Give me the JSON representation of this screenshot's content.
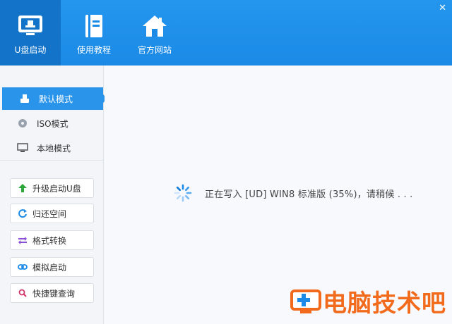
{
  "header": {
    "nav": [
      {
        "label": "U盘启动",
        "icon": "usb-monitor-icon",
        "active": true
      },
      {
        "label": "使用教程",
        "icon": "book-icon",
        "active": false
      },
      {
        "label": "官方网站",
        "icon": "home-icon",
        "active": false
      }
    ],
    "close_glyph": "✕"
  },
  "sidebar": {
    "modes": [
      {
        "label": "默认模式",
        "icon": "usb-drive-icon",
        "active": true
      },
      {
        "label": "ISO模式",
        "icon": "disc-icon",
        "active": false
      },
      {
        "label": "本地模式",
        "icon": "monitor-icon",
        "active": false
      }
    ],
    "tools": [
      {
        "label": "升级启动U盘",
        "icon": "arrow-up-icon",
        "color": "#2fa63c"
      },
      {
        "label": "归还空间",
        "icon": "refresh-icon",
        "color": "#1a8ae6"
      },
      {
        "label": "格式转换",
        "icon": "swap-icon",
        "color": "#8a4fd6"
      },
      {
        "label": "模拟启动",
        "icon": "link-icon",
        "color": "#1a8ae6"
      },
      {
        "label": "快捷键查询",
        "icon": "search-icon",
        "color": "#d0346a"
      }
    ]
  },
  "main": {
    "status": "正在写入 [UD] WIN8 标准版 (35%)，请稍候 . . .",
    "progress_percent": 35
  },
  "watermark": {
    "text": "电脑技术吧"
  },
  "colors": {
    "header": "#1a8ae6",
    "active_nav": "#1273c9",
    "accent": "#2a93ea",
    "watermark": "#f26b1d"
  }
}
